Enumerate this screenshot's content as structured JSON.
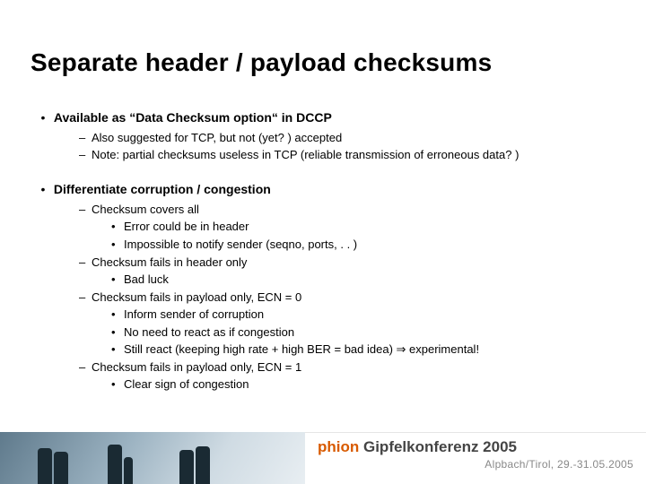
{
  "title": "Separate header / payload checksums",
  "section1": {
    "heading": "Available as “Data Checksum option“ in DCCP",
    "b2a": "Also suggested for TCP, but not (yet? ) accepted",
    "b2b": "Note: partial checksums useless in TCP (reliable transmission of erroneous data? )"
  },
  "section2": {
    "heading": "Differentiate corruption / congestion",
    "g1": {
      "h": "Checksum covers all",
      "a": "Error could be in header",
      "b": "Impossible to notify sender (seqno, ports, . . )"
    },
    "g2": {
      "h": "Checksum fails in header only",
      "a": "Bad luck"
    },
    "g3": {
      "h": "Checksum fails in payload only, ECN = 0",
      "a": "Inform sender of corruption",
      "b": "No need to react as if congestion",
      "c": "Still react (keeping high rate + high BER = bad idea) ⇒ experimental!"
    },
    "g4": {
      "h": "Checksum fails in payload only, ECN = 1",
      "a": "Clear sign of congestion"
    }
  },
  "footer": {
    "brand": "phion",
    "conf": " Gipfelkonferenz 2005",
    "sub": "Alpbach/Tirol, 29.-31.05.2005"
  }
}
